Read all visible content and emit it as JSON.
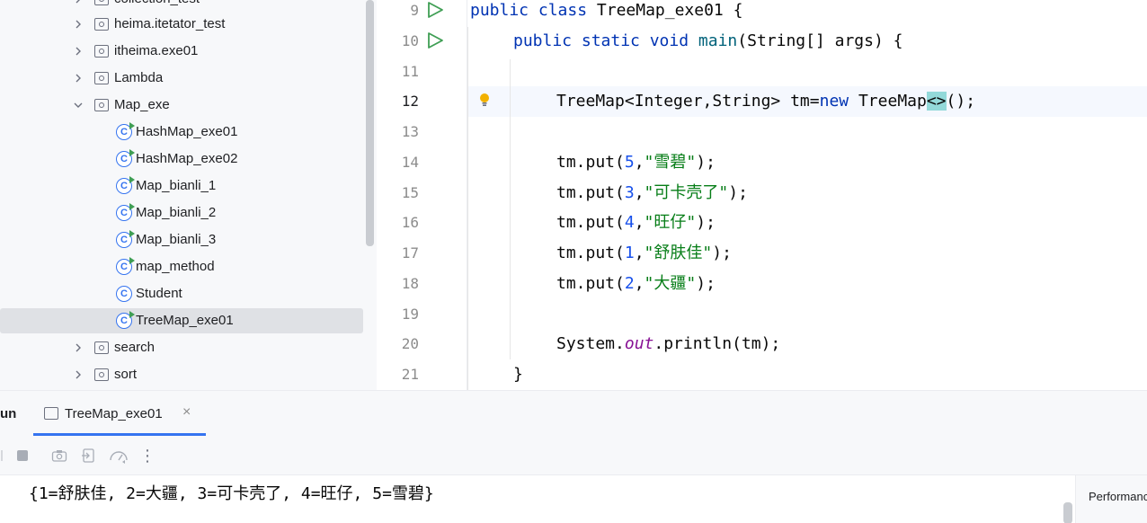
{
  "project_tree": {
    "items": [
      {
        "label": "collection_test",
        "kind": "package",
        "expanded": false
      },
      {
        "label": "heima.itetator_test",
        "kind": "package",
        "expanded": false
      },
      {
        "label": "itheima.exe01",
        "kind": "package",
        "expanded": false
      },
      {
        "label": "Lambda",
        "kind": "package",
        "expanded": false
      },
      {
        "label": "Map_exe",
        "kind": "package",
        "expanded": true
      },
      {
        "label": "HashMap_exe01",
        "kind": "class-runnable"
      },
      {
        "label": "HashMap_exe02",
        "kind": "class-runnable"
      },
      {
        "label": "Map_bianli_1",
        "kind": "class-runnable"
      },
      {
        "label": "Map_bianli_2",
        "kind": "class-runnable"
      },
      {
        "label": "Map_bianli_3",
        "kind": "class-runnable"
      },
      {
        "label": "map_method",
        "kind": "class-runnable"
      },
      {
        "label": "Student",
        "kind": "class"
      },
      {
        "label": "TreeMap_exe01",
        "kind": "class-runnable",
        "selected": true
      },
      {
        "label": "search",
        "kind": "package",
        "expanded": false
      },
      {
        "label": "sort",
        "kind": "package",
        "expanded": false
      }
    ]
  },
  "editor": {
    "lines": [
      {
        "n": "9",
        "tokens": [
          [
            "kw",
            "public class "
          ],
          [
            "",
            "TreeMap_exe01 {"
          ]
        ],
        "indent": 0,
        "run": true
      },
      {
        "n": "10",
        "tokens": [
          [
            "kw",
            "public static void "
          ],
          [
            "mth",
            "main"
          ],
          [
            "",
            "(String[] args) {"
          ]
        ],
        "indent": 1,
        "run": true
      },
      {
        "n": "11",
        "tokens": [],
        "indent": 2
      },
      {
        "n": "12",
        "tokens": [
          [
            "",
            "TreeMap<Integer,String> tm="
          ],
          [
            "kw",
            "new "
          ],
          [
            "",
            "TreeMap"
          ],
          [
            "brace",
            "<>"
          ],
          [
            "",
            "();"
          ]
        ],
        "indent": 2,
        "current": true,
        "bulb": true
      },
      {
        "n": "13",
        "tokens": [],
        "indent": 2
      },
      {
        "n": "14",
        "tokens": [
          [
            "",
            "tm.put("
          ],
          [
            "num",
            "5"
          ],
          [
            "",
            ","
          ],
          [
            "str",
            "\"雪碧\""
          ],
          [
            "",
            ");"
          ]
        ],
        "indent": 2
      },
      {
        "n": "15",
        "tokens": [
          [
            "",
            "tm.put("
          ],
          [
            "num",
            "3"
          ],
          [
            "",
            ","
          ],
          [
            "str",
            "\"可卡壳了\""
          ],
          [
            "",
            ");"
          ]
        ],
        "indent": 2
      },
      {
        "n": "16",
        "tokens": [
          [
            "",
            "tm.put("
          ],
          [
            "num",
            "4"
          ],
          [
            "",
            ","
          ],
          [
            "str",
            "\"旺仔\""
          ],
          [
            "",
            ");"
          ]
        ],
        "indent": 2
      },
      {
        "n": "17",
        "tokens": [
          [
            "",
            "tm.put("
          ],
          [
            "num",
            "1"
          ],
          [
            "",
            ","
          ],
          [
            "str",
            "\"舒肤佳\""
          ],
          [
            "",
            ");"
          ]
        ],
        "indent": 2
      },
      {
        "n": "18",
        "tokens": [
          [
            "",
            "tm.put("
          ],
          [
            "num",
            "2"
          ],
          [
            "",
            ","
          ],
          [
            "str",
            "\"大疆\""
          ],
          [
            "",
            ");"
          ]
        ],
        "indent": 2
      },
      {
        "n": "19",
        "tokens": [],
        "indent": 2
      },
      {
        "n": "20",
        "tokens": [
          [
            "",
            "System."
          ],
          [
            "fld",
            "out"
          ],
          [
            "",
            ".println(tm);"
          ]
        ],
        "indent": 2
      },
      {
        "n": "21",
        "tokens": [
          [
            "",
            "}"
          ]
        ],
        "indent": 1
      }
    ]
  },
  "run_panel": {
    "title": "un",
    "tab_label": "TreeMap_exe01",
    "tab_close": "×",
    "toolbar": {
      "more": "⋮"
    },
    "output": "{1=舒肤佳, 2=大疆, 3=可卡壳了, 4=旺仔, 5=雪碧}",
    "side_tab": "Performance"
  },
  "colors": {
    "accent": "#3574f0",
    "keyword": "#0033b3",
    "string": "#067d17",
    "number": "#1750eb",
    "field": "#871094",
    "run_green": "#3f9e54"
  }
}
